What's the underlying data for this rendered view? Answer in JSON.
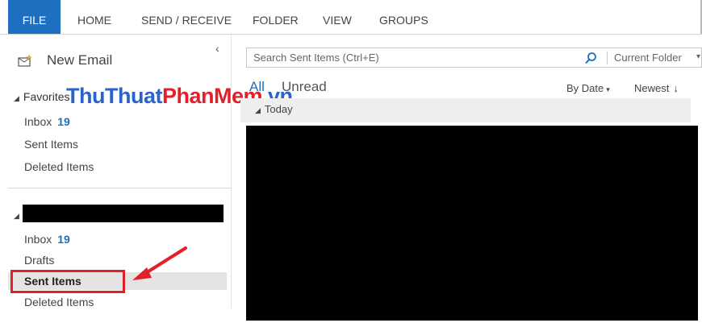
{
  "ribbon": {
    "tabs": [
      "FILE",
      "HOME",
      "SEND / RECEIVE",
      "FOLDER",
      "VIEW",
      "GROUPS"
    ]
  },
  "nav": {
    "new_email_label": "New Email",
    "favorites": {
      "label": "Favorites",
      "items": [
        {
          "label": "Inbox",
          "count": "19"
        },
        {
          "label": "Sent Items"
        },
        {
          "label": "Deleted Items"
        }
      ]
    },
    "account": {
      "items": [
        {
          "label": "Inbox",
          "count": "19"
        },
        {
          "label": "Drafts"
        },
        {
          "label": "Sent Items"
        },
        {
          "label": "Deleted Items"
        }
      ]
    }
  },
  "watermark": {
    "part1": "ThuThuat",
    "part2": "PhanMem",
    "part3": ".vn"
  },
  "message_list": {
    "search_placeholder": "Search Sent Items (Ctrl+E)",
    "scope": "Current Folder",
    "filters": {
      "all": "All",
      "unread": "Unread"
    },
    "sort": {
      "by": "By Date",
      "order": "Newest"
    },
    "group_label": "Today"
  },
  "colors": {
    "accent": "#1e6fc0",
    "highlight": "#e0202a"
  },
  "icons": [
    "new-email-icon",
    "collapse-chevron-icon",
    "search-icon",
    "red-arrow-icon"
  ]
}
